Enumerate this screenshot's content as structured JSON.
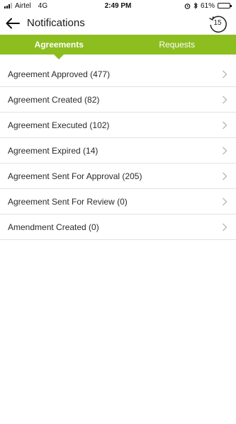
{
  "status_bar": {
    "carrier": "Airtel",
    "network": "4G",
    "time": "2:49 PM",
    "battery": "61%",
    "battery_level": 0.61
  },
  "header": {
    "title": "Notifications",
    "back_icon": "arrow-left-icon",
    "history_icon": "history-icon",
    "history_count": "15"
  },
  "tabs": [
    {
      "label": "Agreements",
      "active": true
    },
    {
      "label": "Requests",
      "active": false
    }
  ],
  "notifications": [
    {
      "label": "Agreement Approved (477)"
    },
    {
      "label": "Agreement Created (82)"
    },
    {
      "label": "Agreement Executed (102)"
    },
    {
      "label": "Agreement Expired (14)"
    },
    {
      "label": "Agreement Sent For Approval (205)"
    },
    {
      "label": "Agreement Sent For Review (0)"
    },
    {
      "label": "Amendment Created (0)"
    }
  ],
  "colors": {
    "accent": "#8cbe1f",
    "divider": "#e2e2e2",
    "chevron": "#b8b8b8"
  }
}
